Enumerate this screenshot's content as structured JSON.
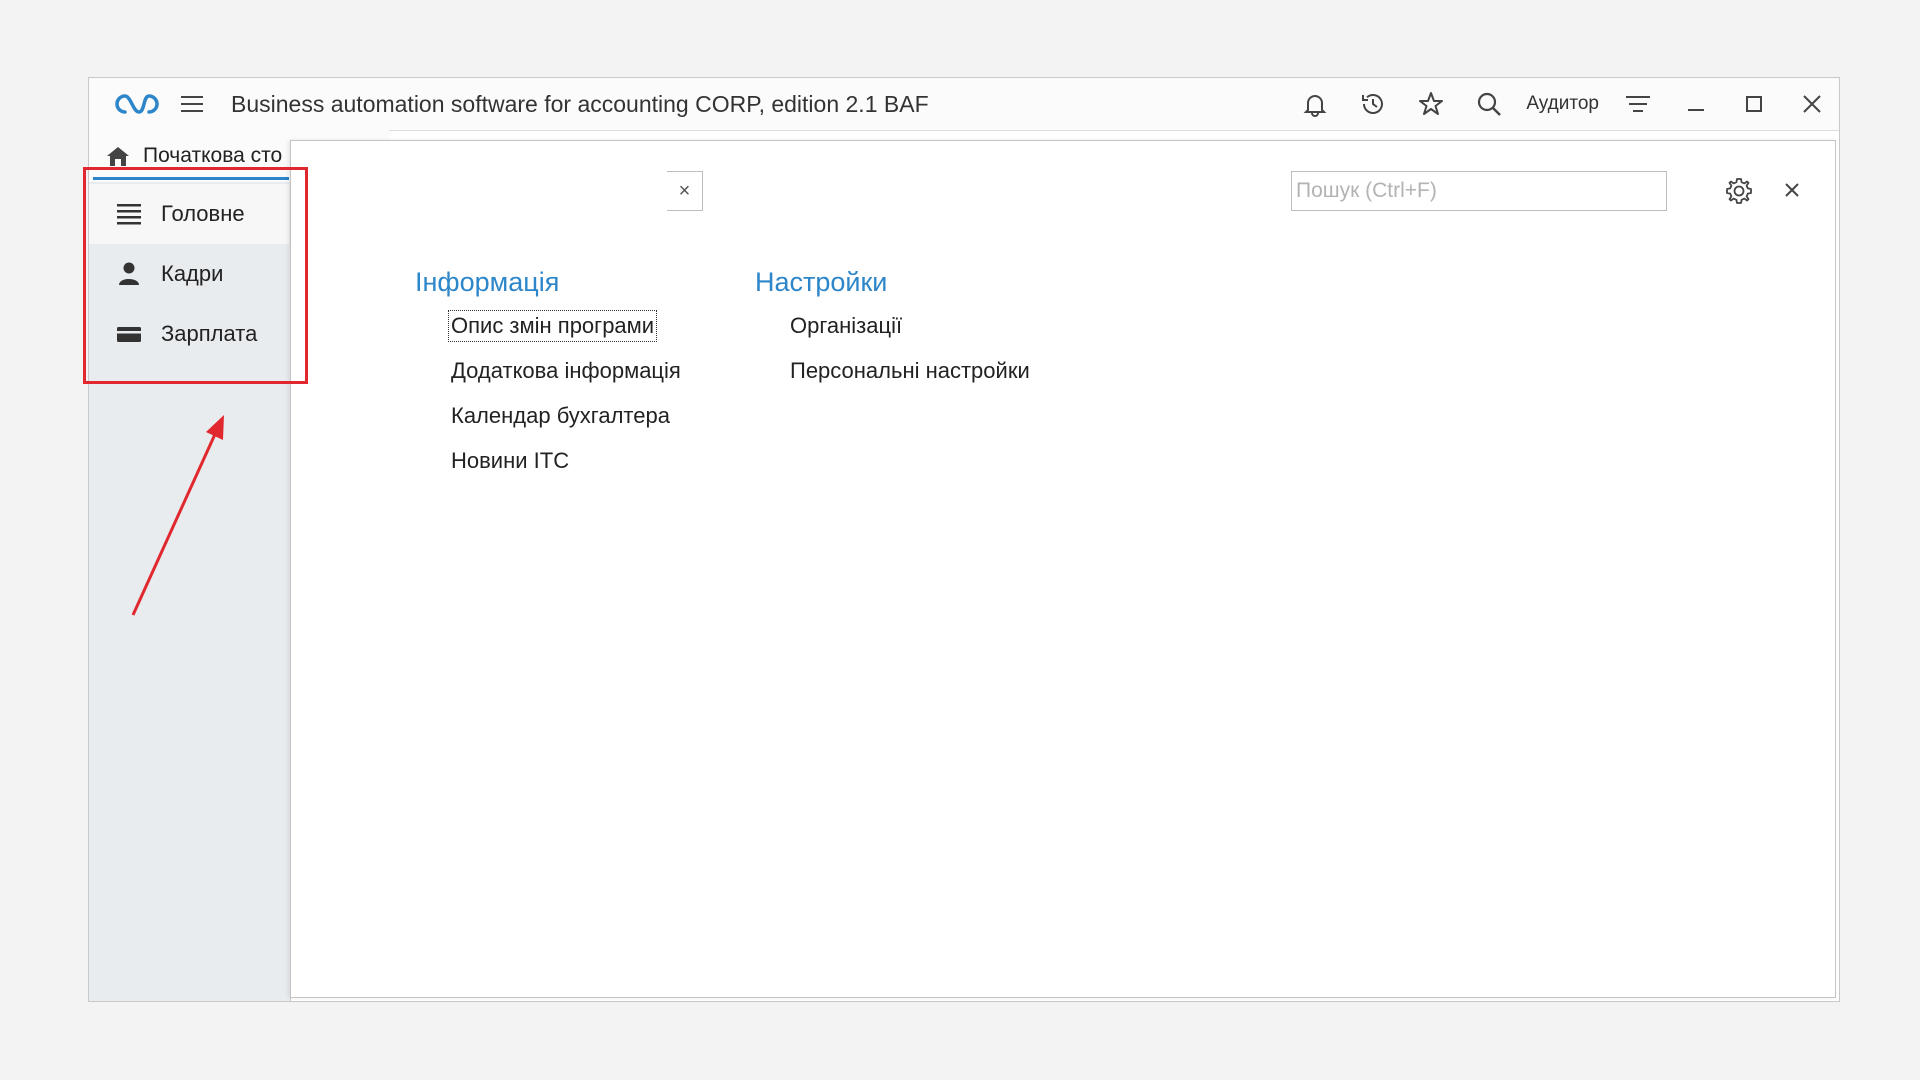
{
  "titlebar": {
    "app_title": "Business automation software for accounting CORP, edition 2.1 BAF",
    "user_name": "Аудитор",
    "icons": [
      "bell-icon",
      "history-icon",
      "star-icon",
      "search-icon",
      "filter-icon",
      "minimize-icon",
      "maximize-icon",
      "close-icon"
    ]
  },
  "home_tab": {
    "label": "Початкова сто"
  },
  "sidebar": {
    "items": [
      {
        "label": "Головне",
        "icon": "list-icon",
        "active": true
      },
      {
        "label": "Кадри",
        "icon": "person-icon",
        "active": false
      },
      {
        "label": "Зарплата",
        "icon": "wallet-icon",
        "active": false
      }
    ]
  },
  "panel": {
    "search": {
      "placeholder": "Пошук (Ctrl+F)",
      "value": "",
      "clear_label": "×"
    },
    "sections": [
      {
        "title": "Інформація",
        "links": [
          "Опис змін програми",
          "Додаткова інформація",
          "Календар бухгалтера",
          "Новини ІТС"
        ]
      },
      {
        "title": "Настройки",
        "links": [
          "Організації",
          "Персональні настройки"
        ]
      }
    ]
  },
  "colors": {
    "accent": "#2c86c9",
    "annotation": "#e0282e",
    "sidebar_bg": "#e8ecef"
  }
}
